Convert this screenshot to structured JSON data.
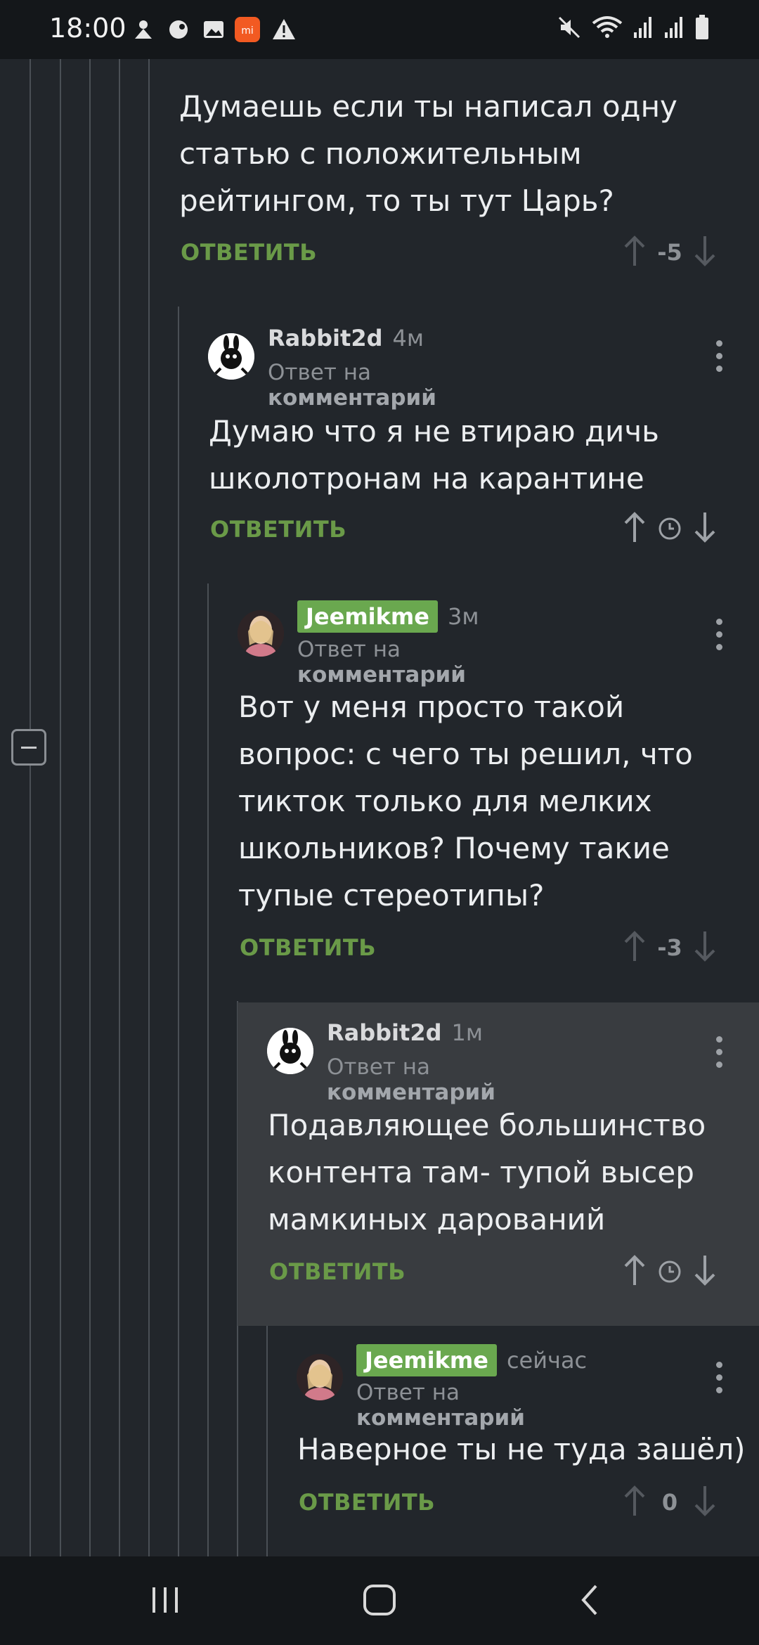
{
  "status_bar": {
    "time": "18:00",
    "left_icons": [
      "android-auto-icon",
      "paint-icon",
      "image-icon",
      "mi-app-icon",
      "warning-icon"
    ],
    "right_icons": [
      "mute-icon",
      "wifi-icon",
      "signal-icon",
      "signal-icon",
      "battery-icon"
    ]
  },
  "comments": [
    {
      "text": "Думаешь если ты написал одну статью с положительным рейтингом, то ты тут Царь?",
      "reply_label": "ОТВЕТИТЬ",
      "rating": "-5"
    },
    {
      "author": "Rabbit2d",
      "time": "4м",
      "reply_prefix": "Ответ на",
      "reply_target": "комментарий",
      "text": "Думаю что я не втираю дичь школотронам на карантине",
      "reply_label": "ОТВЕТИТЬ",
      "rating": ""
    },
    {
      "author": "Jeemikme",
      "time": "3м",
      "reply_prefix": "Ответ на",
      "reply_target": "комментарий",
      "text": "Вот у меня просто такой вопрос: с чего ты решил, что тикток только для мелких школьников? Почему такие тупые стереотипы?",
      "reply_label": "ОТВЕТИТЬ",
      "rating": "-3"
    },
    {
      "author": "Rabbit2d",
      "time": "1м",
      "reply_prefix": "Ответ на",
      "reply_target": "комментарий",
      "text": "Подавляющее большинство контента там- тупой высер мамкиных дарований",
      "reply_label": "ОТВЕТИТЬ",
      "rating": ""
    },
    {
      "author": "Jeemikme",
      "time": "сейчас",
      "reply_prefix": "Ответ на",
      "reply_target": "комментарий",
      "text": "Наверное ты не туда зашёл)",
      "reply_label": "ОТВЕТИТЬ",
      "rating": "0"
    }
  ],
  "colors": {
    "background": "#22262b",
    "highlight": "#393c40",
    "accent_green": "#6a9a48",
    "author_badge": "#6aa84f"
  },
  "nav_bar": {
    "buttons": [
      "recents-button",
      "home-button",
      "back-button"
    ]
  }
}
